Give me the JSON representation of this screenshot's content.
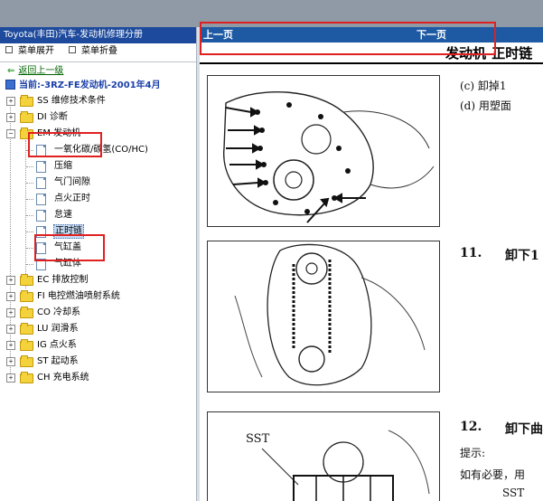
{
  "left_panel": {
    "title": "Toyota(丰田)汽车-发动机修理分册",
    "menu_expand": "菜单展开",
    "menu_collapse": "菜单折叠",
    "back_link": "返回上一级",
    "current": "当前:-3RZ-FE发动机-2001年4月",
    "tree": {
      "ss": "SS 维修技术条件",
      "di": "DI 诊断",
      "em": "EM 发动机",
      "em_children": [
        "一氧化碳/碳氢(CO/HC)",
        "压缩",
        "气门间隙",
        "点火正时",
        "怠速",
        "正时链",
        "气缸盖",
        "气缸体"
      ],
      "ec": "EC 排放控制",
      "fi": "FI 电控燃油喷射系统",
      "co": "CO 冷却系",
      "lu": "LU 润滑系",
      "ig": "IG 点火系",
      "st": "ST 起动系",
      "ch": "CH 充电系统"
    }
  },
  "right_panel": {
    "prev_page": "上一页",
    "next_page": "下一页",
    "section_title": "发动机-正时链",
    "item_c": "(c)    卸掉1",
    "item_d": "(d)    用塑面",
    "step11_num": "11.",
    "step11_text": "卸下1",
    "step12_num": "12.",
    "step12_text": "卸下曲",
    "hint": "提示:",
    "hint_body": "如有必要，用",
    "sst_label_fig": "SST",
    "sst_label_text": "SST"
  },
  "colors": {
    "left_title_bg": "#1d4a9c",
    "nav_bar_bg": "#1e5aa3",
    "current_text": "#1a3fa8",
    "link_text": "#006400",
    "highlight_box": "#e02020"
  }
}
